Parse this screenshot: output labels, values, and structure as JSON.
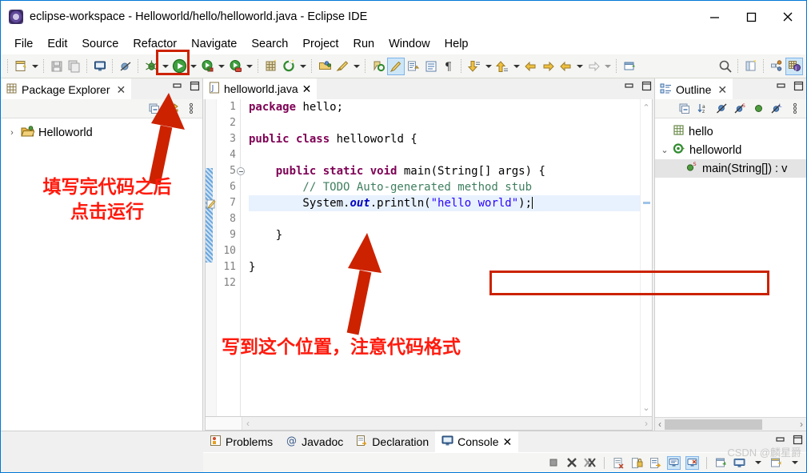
{
  "window": {
    "title": "eclipse-workspace - Helloworld/hello/helloworld.java - Eclipse IDE",
    "icon": "eclipse-icon",
    "minimize_label": "–",
    "maximize_label": "□",
    "close_label": "✕"
  },
  "menubar": {
    "items": [
      {
        "label": "File"
      },
      {
        "label": "Edit"
      },
      {
        "label": "Source"
      },
      {
        "label": "Refactor"
      },
      {
        "label": "Navigate"
      },
      {
        "label": "Search"
      },
      {
        "label": "Project"
      },
      {
        "label": "Run"
      },
      {
        "label": "Window"
      },
      {
        "label": "Help"
      }
    ]
  },
  "toolbar": {
    "items": [
      {
        "name": "new-wizard-icon"
      },
      {
        "name": "new-wizard-dropdown"
      },
      {
        "name": "save-icon"
      },
      {
        "name": "save-all-icon"
      },
      {
        "name": "open-console-icon"
      },
      {
        "name": "skip-breakpoints-icon"
      },
      {
        "name": "debug-icon"
      },
      {
        "name": "debug-dropdown"
      },
      {
        "name": "run-icon"
      },
      {
        "name": "run-dropdown"
      },
      {
        "name": "run-external-tools-icon"
      },
      {
        "name": "external-tools-dropdown"
      },
      {
        "name": "coverage-icon"
      },
      {
        "name": "coverage-dropdown"
      },
      {
        "name": "new-java-project-icon"
      },
      {
        "name": "new-java-class-icon"
      },
      {
        "name": "new-class-dropdown"
      },
      {
        "name": "open-type-icon"
      },
      {
        "name": "open-task-icon"
      },
      {
        "name": "open-task-dropdown"
      },
      {
        "name": "search-marker-icon"
      },
      {
        "name": "toggle-markoccurrences-icon"
      },
      {
        "name": "link-editor-icon"
      },
      {
        "name": "show-whitespace-icon"
      },
      {
        "name": "pilcrow-icon"
      },
      {
        "name": "next-annotation-icon"
      },
      {
        "name": "next-annotation-dropdown"
      },
      {
        "name": "previous-annotation-icon"
      },
      {
        "name": "previous-annotation-dropdown"
      },
      {
        "name": "back-history-icon"
      },
      {
        "name": "forward-history-icon"
      },
      {
        "name": "back-nav-icon"
      },
      {
        "name": "back-nav-dropdown"
      },
      {
        "name": "forward-nav-icon"
      },
      {
        "name": "forward-nav-dropdown"
      },
      {
        "name": "new-window-icon"
      },
      {
        "name": "quick-access-search-icon"
      },
      {
        "name": "open-perspective-icon"
      },
      {
        "name": "perspective-java-browsing-icon"
      },
      {
        "name": "perspective-java-icon"
      }
    ]
  },
  "package_explorer": {
    "tab_label": "Package Explorer",
    "tab_icon": "package-explorer-icon",
    "close_label": "✕",
    "minimize_label": "minimize-icon",
    "maximize_label": "maximize-icon",
    "toolbar": [
      {
        "name": "collapse-all-icon"
      },
      {
        "name": "link-with-editor-icon"
      },
      {
        "name": "view-menu-icon"
      }
    ],
    "tree": [
      {
        "label": "Helloworld",
        "twisty": "›",
        "icon": "java-project-icon",
        "expanded": false
      }
    ]
  },
  "editor": {
    "tab_label": "helloworld.java",
    "tab_icon": "java-file-icon",
    "close_label": "✕",
    "minimize_label": "minimize-icon",
    "maximize_label": "maximize-icon",
    "line_numbers": [
      "1",
      "2",
      "3",
      "4",
      "5",
      "6",
      "7",
      "8",
      "9",
      "10",
      "11",
      "12"
    ],
    "lines": [
      {
        "n": 1,
        "tokens": [
          {
            "t": "kw",
            "v": "package"
          },
          {
            "t": "plain",
            "v": " hello;"
          }
        ]
      },
      {
        "n": 2,
        "tokens": []
      },
      {
        "n": 3,
        "tokens": [
          {
            "t": "kw",
            "v": "public class"
          },
          {
            "t": "plain",
            "v": " helloworld {"
          }
        ]
      },
      {
        "n": 4,
        "tokens": []
      },
      {
        "n": 5,
        "tokens": [
          {
            "t": "plain",
            "v": "    "
          },
          {
            "t": "kw",
            "v": "public static void"
          },
          {
            "t": "plain",
            "v": " main(String[] args) {"
          }
        ]
      },
      {
        "n": 6,
        "tokens": [
          {
            "t": "cmt",
            "v": "        // TODO Auto-generated method stub"
          }
        ]
      },
      {
        "n": 7,
        "tokens": [
          {
            "t": "plain",
            "v": "        System."
          },
          {
            "t": "fld",
            "v": "out"
          },
          {
            "t": "plain",
            "v": ".println("
          },
          {
            "t": "str",
            "v": "\"hello world\""
          },
          {
            "t": "plain",
            "v": ");"
          }
        ],
        "highlight": true,
        "caret": true
      },
      {
        "n": 8,
        "tokens": []
      },
      {
        "n": 9,
        "tokens": [
          {
            "t": "plain",
            "v": "    }"
          }
        ]
      },
      {
        "n": 10,
        "tokens": []
      },
      {
        "n": 11,
        "tokens": [
          {
            "t": "plain",
            "v": "}"
          }
        ]
      },
      {
        "n": 12,
        "tokens": []
      }
    ],
    "scroll_up_label": "⌃",
    "scroll_down_label": "⌄",
    "hscroll_left_label": "‹",
    "hscroll_right_label": "›"
  },
  "outline": {
    "tab_label": "Outline",
    "tab_icon": "outline-icon",
    "close_label": "✕",
    "minimize_label": "minimize-icon",
    "maximize_label": "maximize-icon",
    "toolbar": [
      {
        "name": "collapse-all-icon"
      },
      {
        "name": "sort-icon"
      },
      {
        "name": "hide-fields-icon"
      },
      {
        "name": "hide-static-icon"
      },
      {
        "name": "hide-nonpublic-icon"
      },
      {
        "name": "hide-local-types-icon"
      },
      {
        "name": "view-menu-icon"
      }
    ],
    "tree": [
      {
        "label": "hello",
        "icon": "package-icon",
        "twisty": "",
        "indent": 22,
        "selected": false
      },
      {
        "label": "helloworld",
        "icon": "class-icon",
        "twisty": "⌄",
        "indent": 6,
        "selected": false
      },
      {
        "label": "main(String[]) : v",
        "icon": "method-icon",
        "twisty": "",
        "indent": 38,
        "selected": true
      }
    ],
    "hscroll_left_label": "‹",
    "hscroll_right_label": "›"
  },
  "bottom_panel": {
    "tabs": [
      {
        "label": "Problems",
        "icon": "problems-icon",
        "active": false
      },
      {
        "label": "Javadoc",
        "icon": "javadoc-icon",
        "active": false
      },
      {
        "label": "Declaration",
        "icon": "declaration-icon",
        "active": false
      },
      {
        "label": "Console",
        "icon": "console-icon",
        "active": true,
        "close_label": "✕"
      }
    ],
    "minimize_label": "minimize-icon",
    "maximize_label": "maximize-icon",
    "toolbar": [
      {
        "name": "terminate-icon"
      },
      {
        "name": "remove-launch-icon"
      },
      {
        "name": "remove-all-terminated-icon"
      },
      {
        "name": "clear-console-icon"
      },
      {
        "name": "scroll-lock-icon"
      },
      {
        "name": "word-wrap-icon"
      },
      {
        "name": "show-console-on-output-icon"
      },
      {
        "name": "pin-console-icon"
      },
      {
        "name": "display-selected-console-icon"
      },
      {
        "name": "display-console-dropdown"
      },
      {
        "name": "open-console-icon"
      },
      {
        "name": "open-console-dropdown"
      }
    ]
  },
  "annotations": [
    {
      "id": "anno1",
      "lines": [
        "填写完代码之后",
        "点击运行"
      ]
    },
    {
      "id": "anno2",
      "lines": [
        "写到这个位置，注意代码格式"
      ]
    }
  ],
  "watermark": {
    "text": "CSDN @麟星爵"
  },
  "colors": {
    "annotation_red": "#ff1a0d",
    "highlight_box": "#cc2200",
    "keyword": "#7f0055",
    "string": "#2a00ff",
    "comment": "#3f7f5f",
    "field": "#0000c0",
    "selection": "#e8f2fe",
    "window_border": "#0078d7"
  }
}
